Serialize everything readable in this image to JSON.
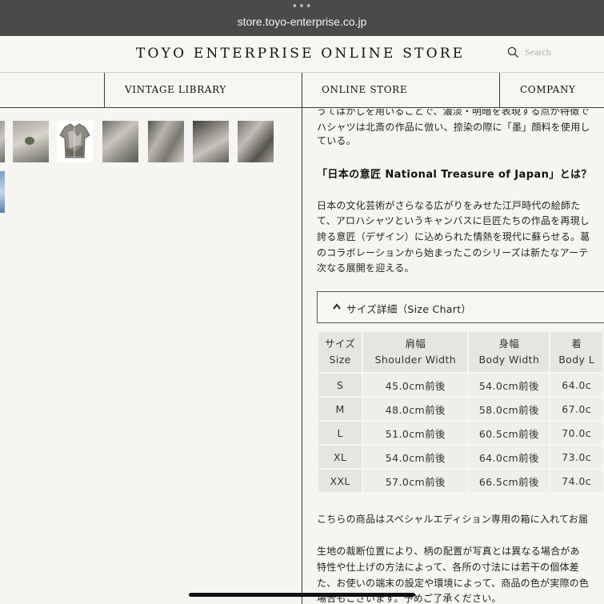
{
  "browser": {
    "dots": "•••",
    "url": "store.toyo-enterprise.co.jp"
  },
  "header": {
    "brand": "TOYO ENTERPRISE ONLINE STORE",
    "search_placeholder": "Search"
  },
  "nav": {
    "items": [
      "VINTAGE LIBRARY",
      "ONLINE STORE",
      "COMPANY"
    ]
  },
  "content": {
    "intro_lines": [
      "うてはかしを用いることで、濃淡・明暗を表現する点が特徴で",
      "ハシャツは北斎の作品に倣い、捺染の際に「墨」顔料を使用し",
      "ている。"
    ],
    "heading": "「日本の意匠 National Treasure of Japan」とは？",
    "body_lines": [
      "日本の文化芸術がさらなる広がりをみせた江戸時代の絵師た",
      "て、アロハシャツというキャンバスに巨匠たちの作品を再現し",
      "誇る意匠（デザイン）に込められた情熱を現代に蘇らせる。葛",
      "のコラボレーションから始まったこのシリーズは新たなアーテ",
      "次なる展開を迎える。"
    ],
    "accordion_label": "サイズ詳細（Size Chart）",
    "footer_line": "こちらの商品はスペシャルエディション専用の箱に入れてお届",
    "notes_lines": [
      "生地の裁断位置により、柄の配置が写真とは異なる場合があ",
      "特性や仕上げの方法によって、各所の寸法には若干の個体差",
      "た、お使いの端末の設定や環境によって、商品の色が実際の色",
      "場合もございます。予めご了承ください。"
    ]
  },
  "size_chart": {
    "headers": [
      [
        "サイズ",
        "Size"
      ],
      [
        "肩幅",
        "Shoulder Width"
      ],
      [
        "身幅",
        "Body Width"
      ],
      [
        "着",
        "Body L"
      ]
    ],
    "rows": [
      [
        "S",
        "45.0cm前後",
        "54.0cm前後",
        "64.0c"
      ],
      [
        "M",
        "48.0cm前後",
        "58.0cm前後",
        "67.0c"
      ],
      [
        "L",
        "51.0cm前後",
        "60.5cm前後",
        "70.0c"
      ],
      [
        "XL",
        "54.0cm前後",
        "64.0cm前後",
        "73.0c"
      ],
      [
        "XXL",
        "57.0cm前後",
        "66.5cm前後",
        "74.0c"
      ]
    ]
  }
}
